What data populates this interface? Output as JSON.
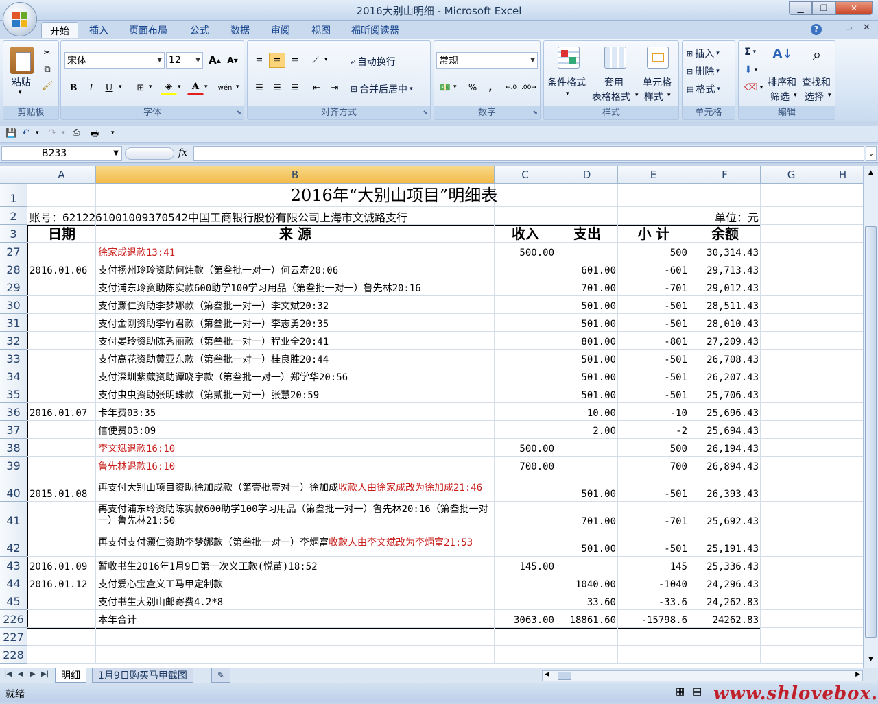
{
  "window": {
    "title": "2016大别山明细 - Microsoft Excel"
  },
  "tabs": [
    "开始",
    "插入",
    "页面布局",
    "公式",
    "数据",
    "审阅",
    "视图",
    "福昕阅读器"
  ],
  "ribbon": {
    "clipboard": {
      "label": "剪贴板",
      "paste": "粘贴"
    },
    "font": {
      "label": "字体",
      "name": "宋体",
      "size": "12",
      "bold": "B",
      "italic": "I",
      "underline": "U",
      "grow": "A",
      "shrink": "A",
      "wen": "wén"
    },
    "alignment": {
      "label": "对齐方式",
      "wrap": "自动换行",
      "merge": "合并后居中"
    },
    "number": {
      "label": "数字",
      "format": "常规",
      "percent": "%",
      "comma": ","
    },
    "styles": {
      "label": "样式",
      "conditional": "条件格式",
      "table_l1": "套用",
      "table_l2": "表格格式",
      "cell_l1": "单元格",
      "cell_l2": "样式"
    },
    "cells": {
      "label": "单元格",
      "insert": "插入",
      "delete": "删除",
      "format": "格式"
    },
    "editing": {
      "label": "编辑",
      "sigma": "Σ",
      "sort_l1": "排序和",
      "sort_l2": "筛选",
      "find_l1": "查找和",
      "find_l2": "选择"
    }
  },
  "formula": {
    "namebox": "B233",
    "fx": "fx",
    "value": ""
  },
  "columns": [
    {
      "name": "A",
      "w": 100
    },
    {
      "name": "B",
      "w": 581
    },
    {
      "name": "C",
      "w": 90
    },
    {
      "name": "D",
      "w": 90
    },
    {
      "name": "E",
      "w": 104
    },
    {
      "name": "F",
      "w": 104
    },
    {
      "name": "G",
      "w": 90
    },
    {
      "name": "H",
      "w": 60
    }
  ],
  "sheet": {
    "title": "2016年“大别山项目”明细表",
    "account": "账号：6212261001009370542中国工商银行股份有限公司上海市文诚路支行",
    "unit": "单位：元",
    "headers": {
      "date": "日期",
      "source": "来 源",
      "income": "收入",
      "expense": "支出",
      "subtotal": "小 计",
      "balance": "余额"
    },
    "rows": [
      {
        "n": "27",
        "h": 26,
        "date": "",
        "src": [
          {
            "t": "徐家成退款13:41",
            "red": true
          }
        ],
        "inc": "500.00",
        "exp": "",
        "sub": "500",
        "bal": "30,314.43"
      },
      {
        "n": "28",
        "h": 26,
        "date": "2016.01.06",
        "src": [
          {
            "t": "支付扬州玲玲资助何炜款（第叁批一对一）何云寿20:06"
          }
        ],
        "inc": "",
        "exp": "601.00",
        "sub": "-601",
        "bal": "29,713.43"
      },
      {
        "n": "29",
        "h": 26,
        "date": "",
        "src": [
          {
            "t": "支付浦东玲资助陈实款600助学100学习用品（第叁批一对一）鲁先林20:16"
          }
        ],
        "inc": "",
        "exp": "701.00",
        "sub": "-701",
        "bal": "29,012.43"
      },
      {
        "n": "30",
        "h": 26,
        "date": "",
        "src": [
          {
            "t": "支付灏仁资助李梦娜款（第叁批一对一）李文斌20:32"
          }
        ],
        "inc": "",
        "exp": "501.00",
        "sub": "-501",
        "bal": "28,511.43"
      },
      {
        "n": "31",
        "h": 26,
        "date": "",
        "src": [
          {
            "t": "支付金刚资助李竹君款（第叁批一对一）李志勇20:35"
          }
        ],
        "inc": "",
        "exp": "501.00",
        "sub": "-501",
        "bal": "28,010.43"
      },
      {
        "n": "32",
        "h": 26,
        "date": "",
        "src": [
          {
            "t": "支付晏玲资助陈秀丽款（第叁批一对一）程业全20:41"
          }
        ],
        "inc": "",
        "exp": "801.00",
        "sub": "-801",
        "bal": "27,209.43"
      },
      {
        "n": "33",
        "h": 26,
        "date": "",
        "src": [
          {
            "t": "支付高花资助黄亚东款（第叁批一对一）桂良胜20:44"
          }
        ],
        "inc": "",
        "exp": "501.00",
        "sub": "-501",
        "bal": "26,708.43"
      },
      {
        "n": "34",
        "h": 26,
        "date": "",
        "src": [
          {
            "t": "支付深圳紫葳资助谭晓宇款（第叁批一对一）郑学华20:56"
          }
        ],
        "inc": "",
        "exp": "501.00",
        "sub": "-501",
        "bal": "26,207.43"
      },
      {
        "n": "35",
        "h": 26,
        "date": "",
        "src": [
          {
            "t": "支付虫虫资助张明珠款（第贰批一对一）张慧20:59"
          }
        ],
        "inc": "",
        "exp": "501.00",
        "sub": "-501",
        "bal": "25,706.43"
      },
      {
        "n": "36",
        "h": 26,
        "date": "2016.01.07",
        "src": [
          {
            "t": "卡年费03:35"
          }
        ],
        "inc": "",
        "exp": "10.00",
        "sub": "-10",
        "bal": "25,696.43"
      },
      {
        "n": "37",
        "h": 26,
        "date": "",
        "src": [
          {
            "t": "信使费03:09"
          }
        ],
        "inc": "",
        "exp": "2.00",
        "sub": "-2",
        "bal": "25,694.43"
      },
      {
        "n": "38",
        "h": 26,
        "date": "",
        "src": [
          {
            "t": "李文斌退款16:10",
            "red": true
          }
        ],
        "inc": "500.00",
        "exp": "",
        "sub": "500",
        "bal": "26,194.43"
      },
      {
        "n": "39",
        "h": 26,
        "date": "",
        "src": [
          {
            "t": "鲁先林退款16:10",
            "red": true
          }
        ],
        "inc": "700.00",
        "exp": "",
        "sub": "700",
        "bal": "26,894.43"
      },
      {
        "n": "40",
        "h": 40,
        "wrap": true,
        "date": "2015.01.08",
        "src": [
          {
            "t": "再支付大别山项目资助徐加成款（第壹批壹对一）徐加成"
          },
          {
            "t": "收款人由徐家成改为徐加成21:46",
            "red": true
          }
        ],
        "inc": "",
        "exp": "501.00",
        "sub": "-501",
        "bal": "26,393.43"
      },
      {
        "n": "41",
        "h": 40,
        "wrap": true,
        "date": "",
        "src": [
          {
            "t": "再支付浦东玲资助陈实款600助学100学习用品（第叁批一对一）鲁先林20:16（第叁批一对一）鲁先林21:50"
          }
        ],
        "inc": "",
        "exp": "701.00",
        "sub": "-701",
        "bal": "25,692.43"
      },
      {
        "n": "42",
        "h": 40,
        "wrap": true,
        "date": "",
        "src": [
          {
            "t": "再支付支付灏仁资助李梦娜款（第叁批一对一）李炳富"
          },
          {
            "t": "收款人由李文斌改为李炳富21:53",
            "red": true
          }
        ],
        "inc": "",
        "exp": "501.00",
        "sub": "-501",
        "bal": "25,191.43"
      },
      {
        "n": "43",
        "h": 26,
        "date": "2016.01.09",
        "src": [
          {
            "t": "暂收书生2016年1月9日第一次义工款(悦苗)18:52"
          }
        ],
        "inc": "145.00",
        "exp": "",
        "sub": "145",
        "bal": "25,336.43"
      },
      {
        "n": "44",
        "h": 26,
        "date": "2016.01.12",
        "src": [
          {
            "t": "支付爱心宝盒义工马甲定制款"
          }
        ],
        "inc": "",
        "exp": "1040.00",
        "sub": "-1040",
        "bal": "24,296.43"
      },
      {
        "n": "45",
        "h": 26,
        "date": "",
        "src": [
          {
            "t": "支付书生大别山邮寄费4.2*8"
          }
        ],
        "inc": "",
        "exp": "33.60",
        "sub": "-33.6",
        "bal": "24,262.83"
      },
      {
        "n": "226",
        "h": 26,
        "date": "",
        "src": [
          {
            "t": "本年合计"
          }
        ],
        "inc": "3063.00",
        "exp": "18861.60",
        "sub": "-15798.6",
        "bal": "24262.83"
      },
      {
        "n": "227",
        "h": 26,
        "empty": true
      },
      {
        "n": "228",
        "h": 26,
        "empty": true
      }
    ]
  },
  "sheettabs": [
    "明细",
    "1月9日购买马甲截图"
  ],
  "status": {
    "ready": "就绪",
    "watermark": "www.shlovebox.com"
  },
  "colors": {
    "red": "#c8201d",
    "selected_col": "#f2bb4b",
    "ribbon": "#dbe7f5"
  }
}
